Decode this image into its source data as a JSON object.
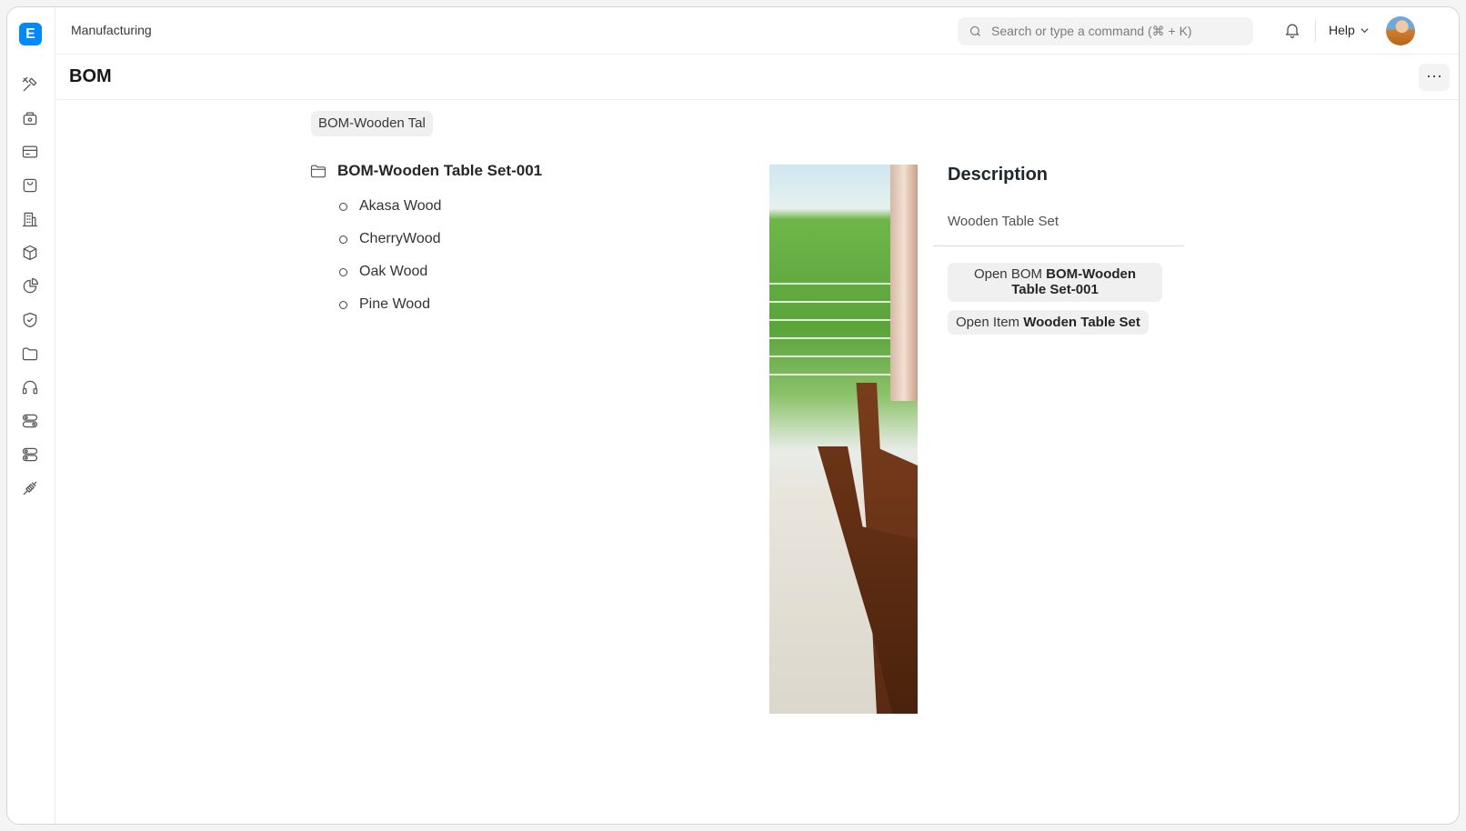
{
  "app": {
    "logo_letter": "E"
  },
  "sidebar": {
    "items": [
      {
        "icon": "tools-icon"
      },
      {
        "icon": "cash-register-icon"
      },
      {
        "icon": "credit-card-icon"
      },
      {
        "icon": "shopping-bag-icon"
      },
      {
        "icon": "building-icon"
      },
      {
        "icon": "box-icon"
      },
      {
        "icon": "pie-chart-icon"
      },
      {
        "icon": "shield-icon"
      },
      {
        "icon": "folder-icon"
      },
      {
        "icon": "headset-icon"
      },
      {
        "icon": "toggle-icon"
      },
      {
        "icon": "toggle-alt-icon"
      },
      {
        "icon": "integration-plug-icon"
      }
    ]
  },
  "navbar": {
    "breadcrumb": "Manufacturing",
    "search_placeholder": "Search or type a command (⌘ + K)",
    "help_label": "Help"
  },
  "page": {
    "title": "BOM",
    "more_label": "···"
  },
  "filter_chip": "BOM-Wooden Tal",
  "tree": {
    "root": "BOM-Wooden Table Set-001",
    "children": [
      "Akasa Wood",
      "CherryWood",
      "Oak Wood",
      "Pine Wood"
    ]
  },
  "details": {
    "heading": "Description",
    "description": "Wooden Table Set",
    "open_bom_prefix": "Open BOM",
    "open_bom_name": "BOM-Wooden Table Set-001",
    "open_item_prefix": "Open Item",
    "open_item_name": "Wooden Table Set"
  }
}
